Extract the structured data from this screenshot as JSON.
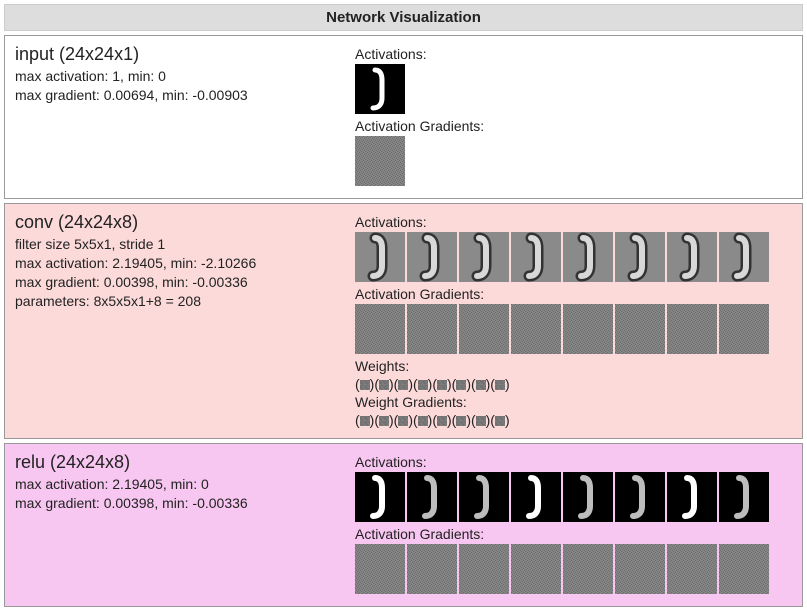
{
  "header": {
    "title": "Network Visualization"
  },
  "section_labels": {
    "activations": "Activations:",
    "activation_grads": "Activation Gradients:",
    "weights": "Weights:",
    "weight_grads": "Weight Gradients:"
  },
  "layers": [
    {
      "kind": "input",
      "title": "input (24x24x1)",
      "meta": [
        "max activation: 1, min: 0",
        "max gradient: 0.00694, min: -0.00903"
      ],
      "activations_count": 1,
      "activation_grads_count": 1,
      "weights_count": 0,
      "weight_grads_count": 0
    },
    {
      "kind": "conv",
      "title": "conv (24x24x8)",
      "meta": [
        "filter size 5x5x1, stride 1",
        "max activation: 2.19405, min: -2.10266",
        "max gradient: 0.00398, min: -0.00336",
        "parameters: 8x5x5x1+8 = 208"
      ],
      "activations_count": 8,
      "activation_grads_count": 8,
      "weights_count": 8,
      "weight_grads_count": 8
    },
    {
      "kind": "relu",
      "title": "relu (24x24x8)",
      "meta": [
        "max activation: 2.19405, min: 0",
        "max gradient: 0.00398, min: -0.00336"
      ],
      "activations_count": 8,
      "activation_grads_count": 8,
      "weights_count": 0,
      "weight_grads_count": 0
    }
  ]
}
